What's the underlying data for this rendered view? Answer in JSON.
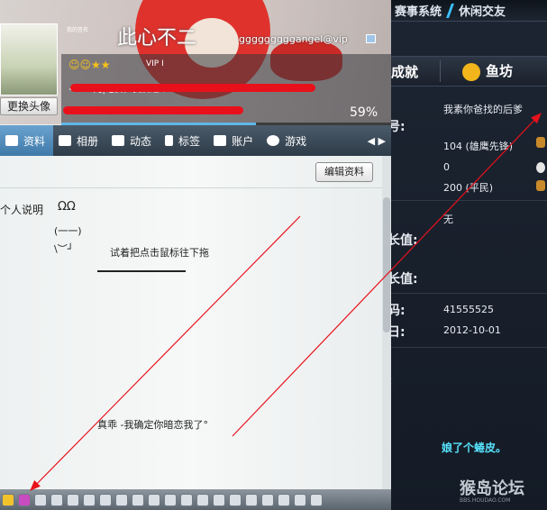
{
  "game": {
    "top_items": [
      "赛事系统",
      "休闲交友"
    ],
    "tab_left": "成就",
    "tab_right": "鱼坊",
    "label_num": "号:",
    "label_grow1": "长值:",
    "label_grow2": "长值:",
    "label_code": "码:",
    "label_birth": "日:",
    "label_misc": ":",
    "value_sign": "我素你爸找的后爹",
    "value_rank": "104 (雄鹰先锋)",
    "value_zero": "0",
    "value_civil": "200 (平民)",
    "value_none": "无",
    "value_id": "41555525",
    "value_date": "2012-10-01",
    "flower_text": "娘了个蜷皮。",
    "watermark_big": "猴岛论坛",
    "watermark_small": "BBS.HOUDAO.COM"
  },
  "profile": {
    "nickname": "此心不二",
    "email": "gggggggggangel@vip",
    "small_tag": "我的签名",
    "vip": "VIP I",
    "sign_partial": "<347元|宅婆，我爱这个",
    "progress_percent": "59%",
    "progress_fraction": 0.59,
    "change_avatar": "更换头像"
  },
  "tabs": [
    {
      "label": "资料",
      "active": true
    },
    {
      "label": "相册",
      "active": false
    },
    {
      "label": "动态",
      "active": false
    },
    {
      "label": "标签",
      "active": false
    },
    {
      "label": "账户",
      "active": false
    },
    {
      "label": "游戏",
      "active": false
    }
  ],
  "content": {
    "edit_button": "编辑资料",
    "personal_label": "个人说明",
    "kaomoji1": "ΩΩ",
    "kaomoji2": "(一一)",
    "kaomoji3": "\\︶┘",
    "drag_hint": "试着把点击鼠标往下拖",
    "bottom_text": "真乖 -我确定你暗恋我了°"
  },
  "colors": {
    "annotation_red": "#e8111b",
    "accent_blue": "#5fb7e8",
    "flower_cyan": "#58e4ff"
  }
}
